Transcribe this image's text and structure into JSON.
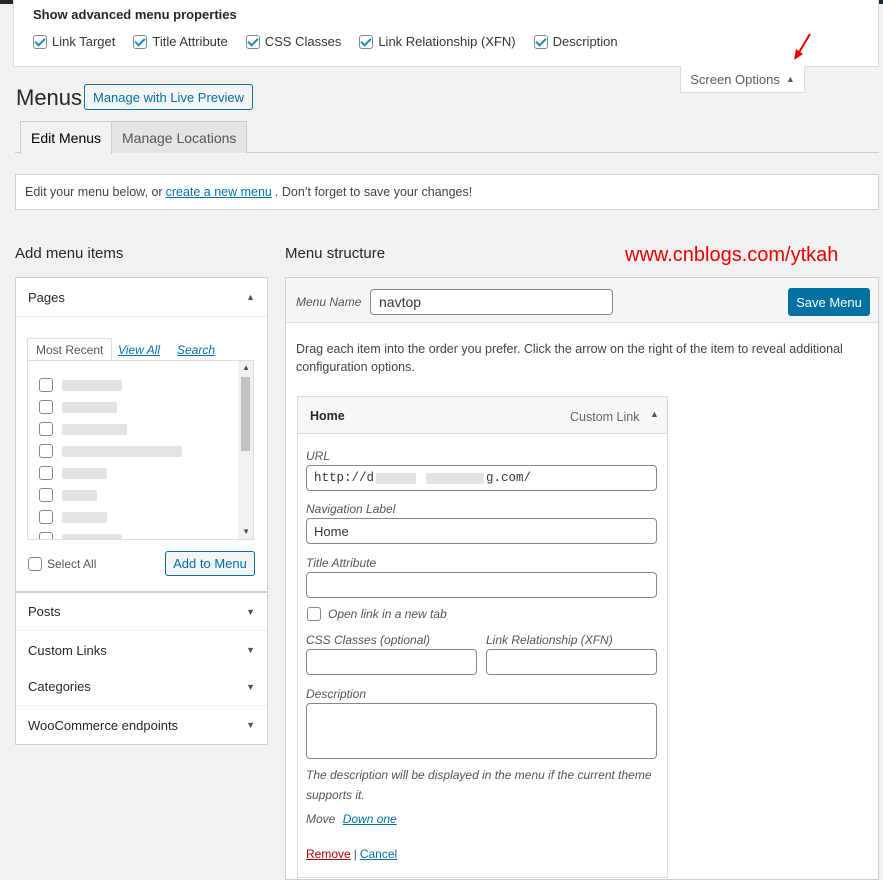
{
  "screen_options": {
    "heading": "Show advanced menu properties",
    "items": [
      {
        "label": "Link Target",
        "checked": true
      },
      {
        "label": "Title Attribute",
        "checked": true
      },
      {
        "label": "CSS Classes",
        "checked": true
      },
      {
        "label": "Link Relationship (XFN)",
        "checked": true
      },
      {
        "label": "Description",
        "checked": true
      }
    ],
    "tab_label": "Screen Options"
  },
  "header": {
    "title": "Menus",
    "live_preview_label": "Manage with Live Preview"
  },
  "tabs": [
    {
      "label": "Edit Menus",
      "active": true
    },
    {
      "label": "Manage Locations",
      "active": false
    }
  ],
  "notice": {
    "before": "Edit your menu below, or",
    "link": "create a new menu",
    "after": ". Don’t forget to save your changes!"
  },
  "left": {
    "heading": "Add menu items",
    "pages": {
      "title": "Pages",
      "tabs": [
        "Most Recent",
        "View All",
        "Search"
      ],
      "select_all": "Select All",
      "add_button": "Add to Menu"
    },
    "sections": [
      "Posts",
      "Custom Links",
      "Categories",
      "WooCommerce endpoints"
    ]
  },
  "right": {
    "heading": "Menu structure",
    "watermark": "www.cnblogs.com/ytkah",
    "menu_name_label": "Menu Name",
    "menu_name_value": "navtop",
    "save_button": "Save Menu",
    "instructions": "Drag each item into the order you prefer. Click the arrow on the right of the item to reveal additional configuration options.",
    "item": {
      "title": "Home",
      "type": "Custom Link",
      "url_label": "URL",
      "url_start": "http://d",
      "url_end": "g.com/",
      "nav_label_label": "Navigation Label",
      "nav_label_value": "Home",
      "title_attr_label": "Title Attribute",
      "new_tab_label": "Open link in a new tab",
      "css_label": "CSS Classes (optional)",
      "xfn_label": "Link Relationship (XFN)",
      "description_label": "Description",
      "description_help": "The description will be displayed in the menu if the current theme supports it.",
      "move_label": "Move",
      "move_link": "Down one",
      "remove": "Remove",
      "separator": "|",
      "cancel": "Cancel"
    }
  },
  "colors": {
    "accent": "#0071a1",
    "watermark": "#e60000",
    "remove": "#aa0000"
  }
}
